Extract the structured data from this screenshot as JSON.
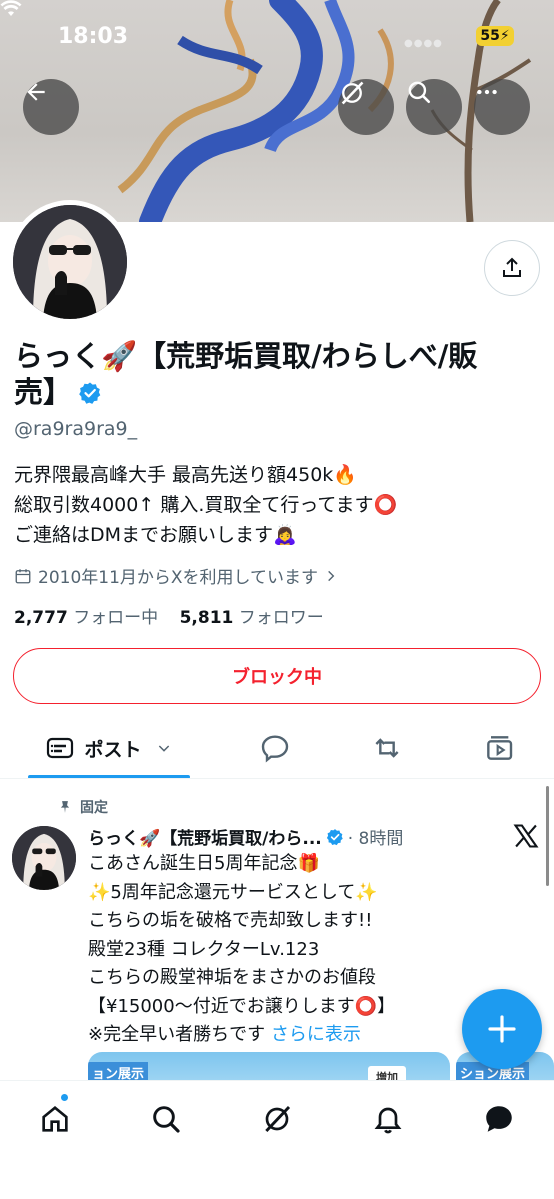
{
  "status_bar": {
    "time": "18:03",
    "battery": "55"
  },
  "profile": {
    "name": "らっく🚀【荒野垢買取/わらしべ/販売】",
    "handle": "@ra9ra9ra9_",
    "bio": [
      "元界隈最高峰大手 最高先送り額450k🔥",
      "総取引数4000↑ 購入.買取全て行ってます⭕",
      "ご連絡はDMまでお願いします🙇‍♀️"
    ],
    "joined": "2010年11月からXを利用しています",
    "following_count": "2,777",
    "following_label": "フォロー中",
    "followers_count": "5,811",
    "followers_label": "フォロワー",
    "block_button": "ブロック中"
  },
  "tabs": {
    "posts_label": "ポスト"
  },
  "post": {
    "pinned_label": "固定",
    "author": "らっく🚀【荒野垢買取/わら...",
    "time": "· 8時間",
    "lines": [
      "こあさん誕生日5周年記念🎁",
      "✨5周年記念還元サービスとして✨",
      "こちらの垢を破格で売却致します!!",
      "殿堂23種 コレクターLv.123",
      "こちらの殿堂神垢をまさかのお値段",
      "【¥15000〜付近でお譲りします⭕】",
      "※完全早い者勝ちです"
    ],
    "show_more": "さらに表示",
    "media_label_1": "ョン展示",
    "media_chip_1": "増加",
    "media_label_2": "ション展示"
  },
  "colors": {
    "accent": "#1d9bf0",
    "block_red": "#f4212e",
    "secondary_text": "#536471"
  }
}
